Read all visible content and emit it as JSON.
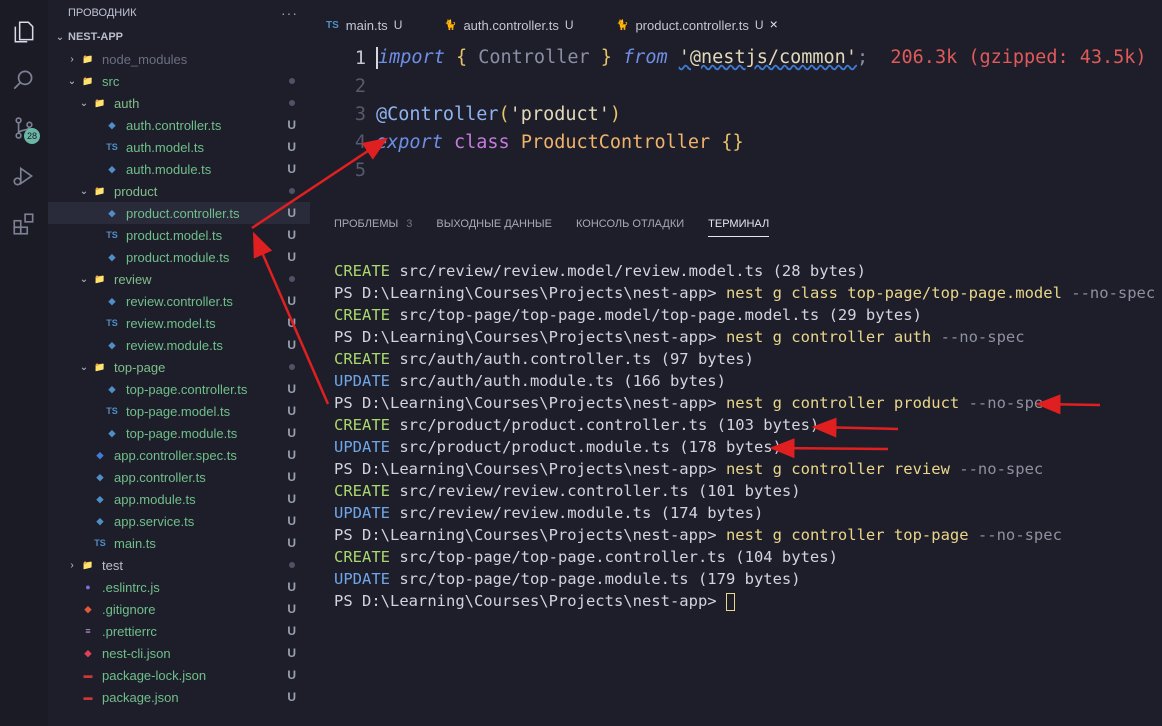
{
  "activity_bar": {
    "items": [
      {
        "name": "explorer-icon",
        "active": true
      },
      {
        "name": "search-icon"
      },
      {
        "name": "source-control-icon",
        "badge": "28"
      },
      {
        "name": "run-debug-icon"
      },
      {
        "name": "extensions-icon"
      }
    ]
  },
  "sidebar": {
    "title": "ПРОВОДНИК",
    "more": "···",
    "root": "NEST-APP",
    "items": [
      {
        "label": "node_modules",
        "depth": 1,
        "kind": "folder",
        "open": false,
        "icon": "node-folder",
        "dim": true
      },
      {
        "label": "src",
        "depth": 1,
        "kind": "folder",
        "open": true,
        "icon": "src-folder",
        "dot": true
      },
      {
        "label": "auth",
        "depth": 2,
        "kind": "folder",
        "open": true,
        "icon": "folder",
        "dot": true
      },
      {
        "label": "auth.controller.ts",
        "depth": 3,
        "kind": "file",
        "icon": "nest",
        "status": "U"
      },
      {
        "label": "auth.model.ts",
        "depth": 3,
        "kind": "file",
        "icon": "ts",
        "status": "U"
      },
      {
        "label": "auth.module.ts",
        "depth": 3,
        "kind": "file",
        "icon": "nest",
        "status": "U"
      },
      {
        "label": "product",
        "depth": 2,
        "kind": "folder",
        "open": true,
        "icon": "folder",
        "dot": true
      },
      {
        "label": "product.controller.ts",
        "depth": 3,
        "kind": "file",
        "icon": "nest",
        "status": "U",
        "selected": true
      },
      {
        "label": "product.model.ts",
        "depth": 3,
        "kind": "file",
        "icon": "ts",
        "status": "U"
      },
      {
        "label": "product.module.ts",
        "depth": 3,
        "kind": "file",
        "icon": "nest",
        "status": "U"
      },
      {
        "label": "review",
        "depth": 2,
        "kind": "folder",
        "open": true,
        "icon": "folder",
        "dot": true
      },
      {
        "label": "review.controller.ts",
        "depth": 3,
        "kind": "file",
        "icon": "nest",
        "status": "U"
      },
      {
        "label": "review.model.ts",
        "depth": 3,
        "kind": "file",
        "icon": "ts",
        "status": "U"
      },
      {
        "label": "review.module.ts",
        "depth": 3,
        "kind": "file",
        "icon": "nest",
        "status": "U"
      },
      {
        "label": "top-page",
        "depth": 2,
        "kind": "folder",
        "open": true,
        "icon": "folder",
        "dot": true
      },
      {
        "label": "top-page.controller.ts",
        "depth": 3,
        "kind": "file",
        "icon": "nest",
        "status": "U"
      },
      {
        "label": "top-page.model.ts",
        "depth": 3,
        "kind": "file",
        "icon": "ts",
        "status": "U"
      },
      {
        "label": "top-page.module.ts",
        "depth": 3,
        "kind": "file",
        "icon": "nest",
        "status": "U"
      },
      {
        "label": "app.controller.spec.ts",
        "depth": 2,
        "kind": "file",
        "icon": "nest-spec",
        "status": "U"
      },
      {
        "label": "app.controller.ts",
        "depth": 2,
        "kind": "file",
        "icon": "nest",
        "status": "U"
      },
      {
        "label": "app.module.ts",
        "depth": 2,
        "kind": "file",
        "icon": "nest",
        "status": "U"
      },
      {
        "label": "app.service.ts",
        "depth": 2,
        "kind": "file",
        "icon": "nest",
        "status": "U"
      },
      {
        "label": "main.ts",
        "depth": 2,
        "kind": "file",
        "icon": "ts",
        "status": "U"
      },
      {
        "label": "test",
        "depth": 1,
        "kind": "folder",
        "open": false,
        "icon": "test-folder",
        "dot": true
      },
      {
        "label": ".eslintrc.js",
        "depth": 1,
        "kind": "file",
        "icon": "eslint",
        "status": "U"
      },
      {
        "label": ".gitignore",
        "depth": 1,
        "kind": "file",
        "icon": "git",
        "status": "U"
      },
      {
        "label": ".prettierrc",
        "depth": 1,
        "kind": "file",
        "icon": "prettier",
        "status": "U"
      },
      {
        "label": "nest-cli.json",
        "depth": 1,
        "kind": "file",
        "icon": "nest-cli",
        "status": "U"
      },
      {
        "label": "package-lock.json",
        "depth": 1,
        "kind": "file",
        "icon": "npm",
        "status": "U"
      },
      {
        "label": "package.json",
        "depth": 1,
        "kind": "file",
        "icon": "npm",
        "status": "U"
      }
    ]
  },
  "tabs": [
    {
      "label": "main.ts",
      "icon": "ts",
      "status": "U"
    },
    {
      "label": "auth.controller.ts",
      "icon": "nest",
      "status": "U"
    },
    {
      "label": "product.controller.ts",
      "icon": "nest",
      "status": "U",
      "active": true,
      "close": "×"
    }
  ],
  "editor": {
    "lines": [
      {
        "n": "1",
        "tokens": [
          [
            "kw",
            "import"
          ],
          [
            "plain",
            " "
          ],
          [
            "punc",
            "{"
          ],
          [
            "ident",
            " Controller "
          ],
          [
            "punc",
            "}"
          ],
          [
            "plain",
            " "
          ],
          [
            "kw",
            "from"
          ],
          [
            "plain",
            " "
          ],
          [
            "str",
            "'@nestjs/common'"
          ],
          [
            "ident",
            ";"
          ],
          [
            "plain",
            "  "
          ],
          [
            "hint",
            "206.3k (gzipped: 43.5k)"
          ]
        ]
      },
      {
        "n": "2",
        "tokens": []
      },
      {
        "n": "3",
        "tokens": [
          [
            "dec",
            "@Controller"
          ],
          [
            "punc",
            "("
          ],
          [
            "str",
            "'product'"
          ],
          [
            "punc",
            ")"
          ]
        ]
      },
      {
        "n": "4",
        "tokens": [
          [
            "kw",
            "export"
          ],
          [
            "plain",
            " "
          ],
          [
            "kw2",
            "class"
          ],
          [
            "plain",
            " "
          ],
          [
            "cls",
            "ProductController"
          ],
          [
            "plain",
            " "
          ],
          [
            "punc",
            "{}"
          ]
        ]
      },
      {
        "n": "5",
        "tokens": []
      }
    ]
  },
  "panel": {
    "tabs": [
      {
        "label": "ПРОБЛЕМЫ",
        "count": "3"
      },
      {
        "label": "ВЫХОДНЫЕ ДАННЫЕ"
      },
      {
        "label": "КОНСОЛЬ ОТЛАДКИ"
      },
      {
        "label": "ТЕРМИНАЛ",
        "active": true
      }
    ],
    "prompt": "PS D:\\Learning\\Courses\\Projects\\nest-app>",
    "lines": [
      {
        "type": "create",
        "word": "CREATE",
        "text": " src/review/review.model/review.model.ts (28 bytes)"
      },
      {
        "type": "cmd",
        "cmd": "nest g class top-page/top-page.model",
        "flag": " --no-spec"
      },
      {
        "type": "create",
        "word": "CREATE",
        "text": " src/top-page/top-page.model/top-page.model.ts (29 bytes)"
      },
      {
        "type": "cmd",
        "cmd": "nest g controller auth",
        "flag": " --no-spec"
      },
      {
        "type": "create",
        "word": "CREATE",
        "text": " src/auth/auth.controller.ts (97 bytes)"
      },
      {
        "type": "update",
        "word": "UPDATE",
        "text": " src/auth/auth.module.ts (166 bytes)"
      },
      {
        "type": "cmd",
        "cmd": "nest g controller product",
        "flag": " --no-spec"
      },
      {
        "type": "create",
        "word": "CREATE",
        "text": " src/product/product.controller.ts (103 bytes)"
      },
      {
        "type": "update",
        "word": "UPDATE",
        "text": " src/product/product.module.ts (178 bytes)"
      },
      {
        "type": "cmd",
        "cmd": "nest g controller review",
        "flag": " --no-spec"
      },
      {
        "type": "create",
        "word": "CREATE",
        "text": " src/review/review.controller.ts (101 bytes)"
      },
      {
        "type": "update",
        "word": "UPDATE",
        "text": " src/review/review.module.ts (174 bytes)"
      },
      {
        "type": "cmd",
        "cmd": "nest g controller top-page",
        "flag": " --no-spec"
      },
      {
        "type": "create",
        "word": "CREATE",
        "text": " src/top-page/top-page.controller.ts (104 bytes)"
      },
      {
        "type": "update",
        "word": "UPDATE",
        "text": " src/top-page/top-page.module.ts (179 bytes)"
      },
      {
        "type": "prompt-cursor"
      }
    ]
  },
  "colors": {
    "annotation_arrow": "#e02020"
  }
}
